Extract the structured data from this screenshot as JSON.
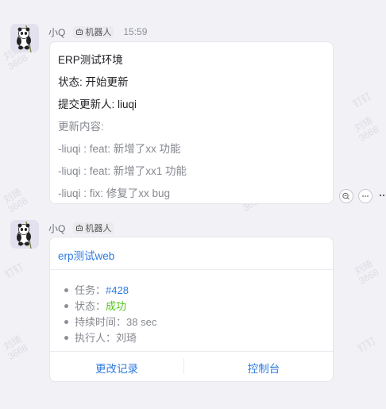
{
  "messages": [
    {
      "sender": "小Q",
      "bot_tag": "机器人",
      "time": "15:59",
      "lines": [
        {
          "text": "ERP测试环境"
        },
        {
          "text": "状态: 开始更新"
        },
        {
          "text": "提交更新人: liuqi"
        },
        {
          "text": "更新内容:"
        },
        {
          "text": "-liuqi : feat: 新增了xx 功能"
        },
        {
          "text": "-liuqi : feat: 新增了xx1 功能"
        },
        {
          "text": "-liuqi : fix: 修复了xx bug"
        }
      ],
      "action_icons": [
        "quote-reply-icon",
        "comment-icon",
        "more-icon"
      ]
    },
    {
      "sender": "小Q",
      "bot_tag": "机器人",
      "title": "erp测试web",
      "details": [
        {
          "label": "任务：",
          "value": "#428"
        },
        {
          "label": "状态：",
          "value": "成功"
        },
        {
          "label": "持续时间：",
          "value": "38 sec"
        },
        {
          "label": "执行人：",
          "value": "刘琦"
        }
      ],
      "buttons": [
        "更改记录",
        "控制台"
      ]
    }
  ],
  "watermark": {
    "name": "刘琦",
    "id": "3668",
    "dup": "钉钉"
  },
  "colors": {
    "link": "#2f7be0",
    "success": "#52c41a",
    "background": "#f2f2f6"
  }
}
